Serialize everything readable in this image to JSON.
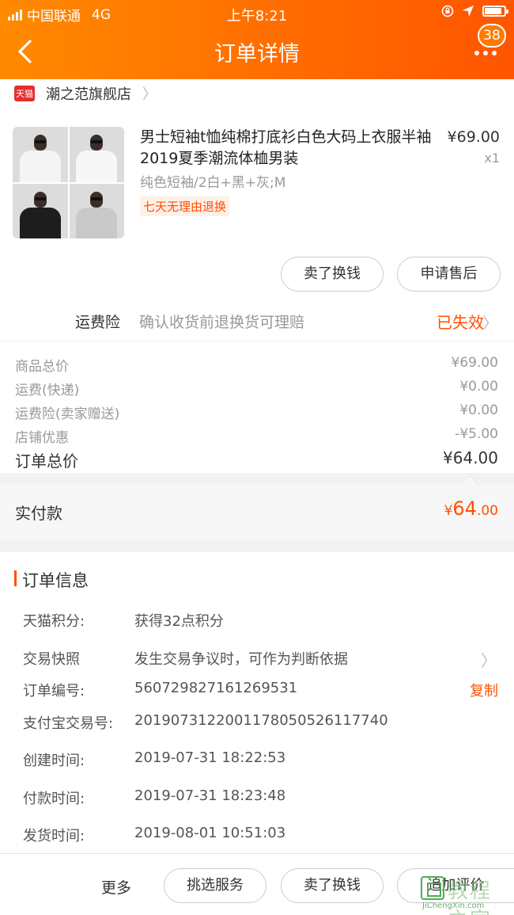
{
  "status_bar": {
    "carrier": "中国联通",
    "network": "4G",
    "time": "上午8:21"
  },
  "nav": {
    "title": "订单详情",
    "message_count": "38"
  },
  "shop": {
    "tag": "天猫",
    "name": "潮之范旗舰店"
  },
  "product": {
    "title": "男士短袖t恤纯棉打底衫白色大码上衣服半袖2019夏季潮流体桖男装",
    "price": "¥69.00",
    "quantity": "x1",
    "spec": "纯色短袖/2白+黑+灰;M",
    "return_tag": "七天无理由退换",
    "buttons": [
      "卖了换钱",
      "申请售后"
    ]
  },
  "insurance": {
    "label": "运费险",
    "desc": "确认收货前退换货可理赔",
    "status": "已失效"
  },
  "fees": [
    {
      "label": "商品总价",
      "value": "¥69.00"
    },
    {
      "label": "运费(快递)",
      "value": "¥0.00"
    },
    {
      "label": "运费险(卖家赠送)",
      "value": "¥0.00"
    },
    {
      "label": "店铺优惠",
      "value": "-¥5.00"
    }
  ],
  "order_total": {
    "label": "订单总价",
    "value": "¥64.00"
  },
  "paid": {
    "label": "实付款",
    "currency": "¥",
    "int": "64",
    "dec": ".00"
  },
  "order_info": {
    "title": "订单信息",
    "rows": [
      {
        "key": "天猫积分:",
        "value": "获得32点积分"
      },
      {
        "key": "交易快照",
        "value": "发生交易争议时，可作为判断依据"
      },
      {
        "key": "订单编号:",
        "value": "560729827161269531",
        "action": "复制"
      },
      {
        "key": "支付宝交易号:",
        "value": "2019073122001178050526117740"
      },
      {
        "key": "创建时间:",
        "value": "2019-07-31 18:22:53"
      },
      {
        "key": "付款时间:",
        "value": "2019-07-31 18:23:48"
      },
      {
        "key": "发货时间:",
        "value": "2019-08-01 10:51:03"
      }
    ]
  },
  "bottom_bar": {
    "more": "更多",
    "buttons": [
      "挑选服务",
      "卖了换钱",
      "追加评价"
    ]
  },
  "watermark": {
    "text": "教程之家",
    "url": "JiChengXin.com"
  },
  "colors": {
    "accent": "#ff5000",
    "header_start": "#ff8a00",
    "header_end": "#ff5500"
  }
}
